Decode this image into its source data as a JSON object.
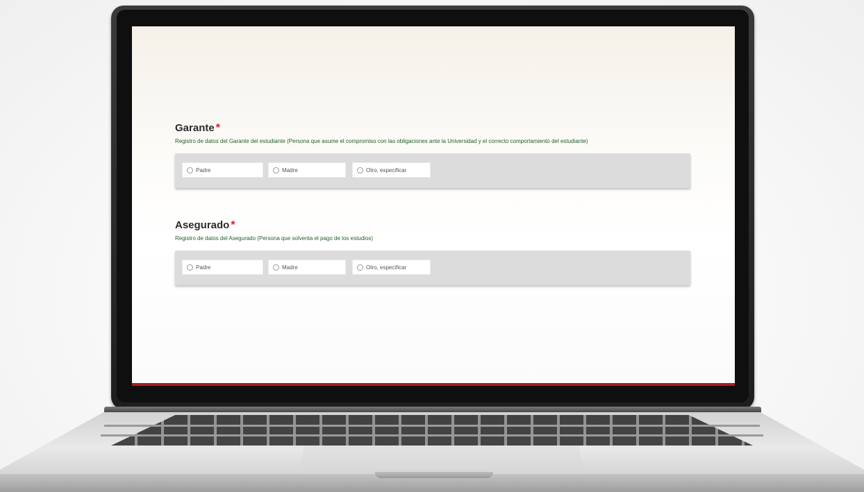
{
  "sections": [
    {
      "title": "Garante",
      "required_mark": "*",
      "description": "Registro de datos del Garante del estudiante (Persona que asume el compromiso con las obligaciones ante la Universidad y el correcto comportamiento del estudiante)",
      "options": [
        "Padre",
        "Madre",
        "Otro, especificar"
      ]
    },
    {
      "title": "Asegurado",
      "required_mark": "*",
      "description": "Registro de datos del Asegurado (Persona que solventa el pago de los estudios)",
      "options": [
        "Padre",
        "Madre",
        "Otro, especificar"
      ]
    }
  ],
  "colors": {
    "required": "#d41f2b",
    "description": "#1f5e27",
    "card_bg": "#dcdcdc",
    "accent_bar": "#ae1c1c"
  }
}
